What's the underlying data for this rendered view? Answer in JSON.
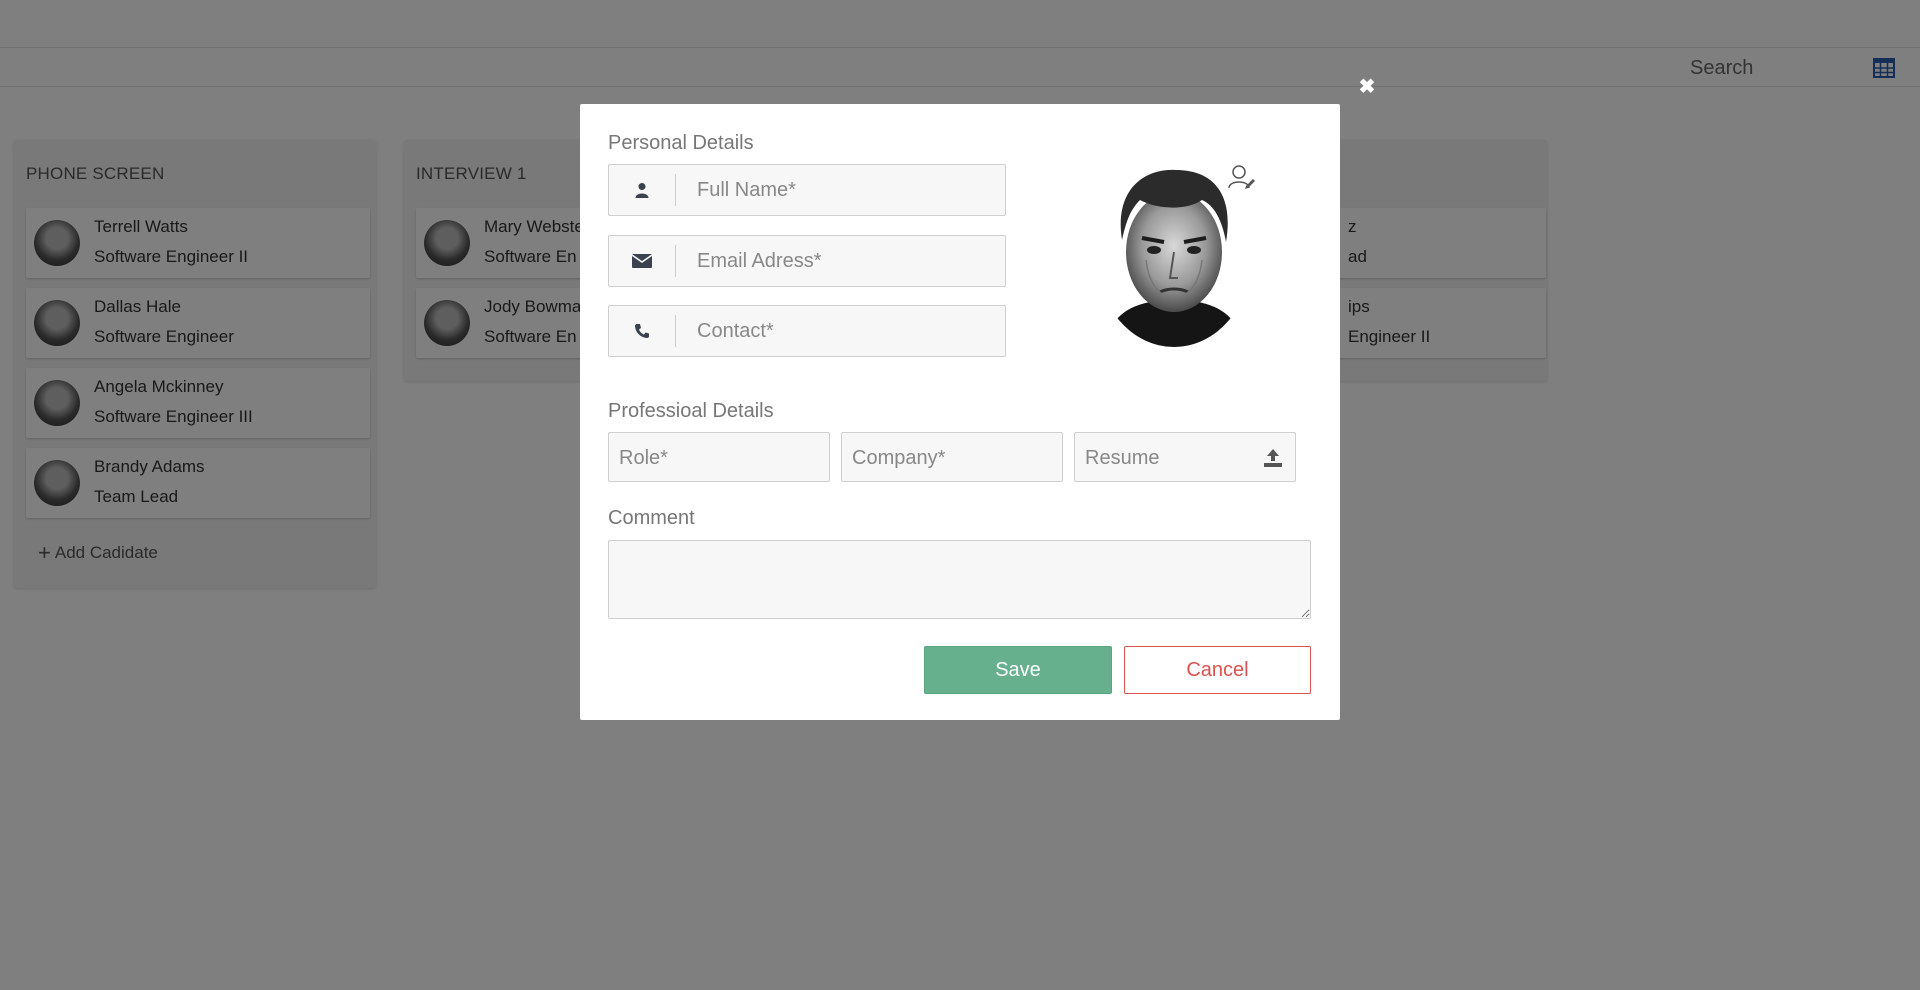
{
  "toolbar": {
    "search_placeholder": "Search",
    "grid_icon": "calendar-grid-icon"
  },
  "columns": [
    {
      "title": "PHONE SCREEN",
      "add_label": "Add Cadidate",
      "cards": [
        {
          "name": "Terrell Watts",
          "role": "Software Engineer II"
        },
        {
          "name": "Dallas Hale",
          "role": "Software Engineer"
        },
        {
          "name": "Angela Mckinney",
          "role": "Software Engineer III"
        },
        {
          "name": "Brandy Adams",
          "role": "Team Lead"
        }
      ]
    },
    {
      "title": "INTERVIEW 1",
      "cards": [
        {
          "name": "Mary Webste",
          "role": "Software En"
        },
        {
          "name": "Jody Bowma",
          "role": "Software En"
        }
      ]
    },
    {
      "title": "",
      "cards": [
        {
          "name": "z",
          "role": "ad"
        },
        {
          "name": "ips",
          "role": "Engineer II"
        }
      ]
    }
  ],
  "modal": {
    "close_symbol": "✖",
    "personal_title": "Personal Details",
    "full_name_placeholder": "Full Name*",
    "email_placeholder": "Email Adress*",
    "contact_placeholder": "Contact*",
    "professional_title": "Professioal Details",
    "role_placeholder": "Role*",
    "company_placeholder": "Company*",
    "resume_placeholder": "Resume",
    "comment_title": "Comment",
    "save_label": "Save",
    "cancel_label": "Cancel"
  },
  "colors": {
    "save": "#66b08e",
    "cancel": "#d9534f",
    "grid_icon": "#2a5db0"
  }
}
